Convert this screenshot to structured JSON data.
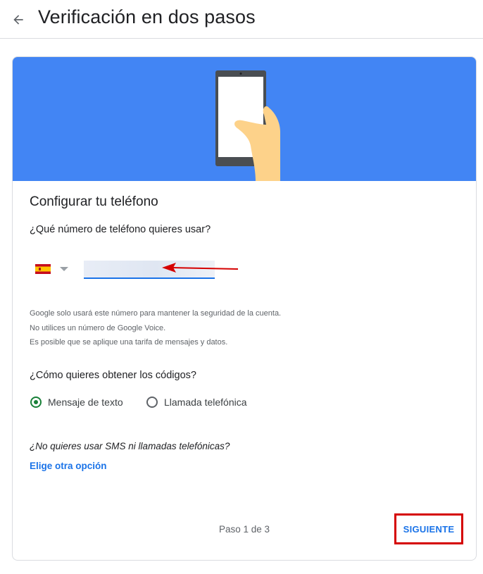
{
  "header": {
    "back_icon": "arrow-back-icon",
    "title": "Verificación en dos pasos"
  },
  "card": {
    "banner_illustration": "hand-holding-phone-illustration",
    "heading": "Configurar tu teléfono",
    "phone_question": "¿Qué número de teléfono quieres usar?",
    "country": {
      "flag_icon": "spain-flag-icon",
      "dropdown_icon": "dropdown-triangle-icon"
    },
    "phone_input": {
      "value": "",
      "annotation_icon": "red-arrow-annotation-icon"
    },
    "info_lines": [
      "Google solo usará este número para mantener la seguridad de la cuenta.",
      "No utilices un número de Google Voice.",
      "Es posible que se aplique una tarifa de mensajes y datos."
    ],
    "codes_question": "¿Cómo quieres obtener los códigos?",
    "options": [
      {
        "label": "Mensaje de texto",
        "selected": true
      },
      {
        "label": "Llamada telefónica",
        "selected": false
      }
    ],
    "no_sms_text": "¿No quieres usar SMS ni llamadas telefónicas?",
    "other_option_link": "Elige otra opción",
    "step_text": "Paso 1 de 3",
    "next_button": "SIGUIENTE"
  },
  "colors": {
    "banner": "#4285f4",
    "link": "#1a73e8",
    "radio_selected": "#188038",
    "annotation": "#d50000"
  }
}
